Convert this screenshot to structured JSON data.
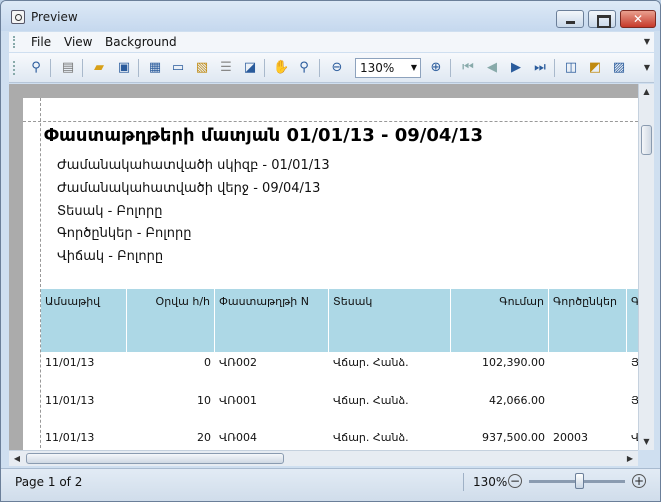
{
  "window": {
    "title": "Preview"
  },
  "menu": {
    "file": "File",
    "view": "View",
    "background": "Background"
  },
  "toolbar": {
    "zoom_value": "130%"
  },
  "report": {
    "title": "Փաստաթղթերի մատյան 01/01/13 - 09/04/13",
    "params": [
      "Ժամանակահատվածի սկիզբ  - 01/01/13",
      "Ժամանակահատվածի վերջ  - 09/04/13",
      "Տեսակ - Բոլորը",
      "Գործընկեր - Բոլորը",
      "Վիճակ - Բոլորը"
    ],
    "columns": [
      "Ամսաթիվ",
      "Օրվա հ/հ",
      "Փաստաթղթի N",
      "Տեսակ",
      "Գումար",
      "Գործընկեր",
      "Գ"
    ],
    "rows": [
      {
        "date": "11/01/13",
        "day_no": "0",
        "doc_no": "ՎՌ002",
        "type": "Վճար. Հանձ.",
        "amount": "102,390.00",
        "partner": "",
        "extra": "Յ"
      },
      {
        "date": "11/01/13",
        "day_no": "10",
        "doc_no": "ՎՌ001",
        "type": "Վճար. Հանձ.",
        "amount": "42,066.00",
        "partner": "",
        "extra": "Յ"
      },
      {
        "date": "11/01/13",
        "day_no": "20",
        "doc_no": "ՎՌ004",
        "type": "Վճար. Հանձ.",
        "amount": "937,500.00",
        "partner": "20003",
        "extra": "Վ"
      }
    ]
  },
  "status": {
    "page": "Page 1 of 2",
    "zoom": "130%"
  },
  "icons": [
    "binoculars-icon",
    "print-options-icon",
    "open-folder-icon",
    "save-icon",
    "page-setup-icon",
    "print-icon",
    "quick-print-icon",
    "page-layout-icon",
    "export-icon",
    "hand-tool-icon",
    "magnifier-icon",
    "zoom-out-icon",
    "zoom-in-icon",
    "first-page-icon",
    "previous-page-icon",
    "next-page-icon",
    "last-page-icon",
    "multipage-icon",
    "background-color-icon",
    "watermark-icon"
  ]
}
